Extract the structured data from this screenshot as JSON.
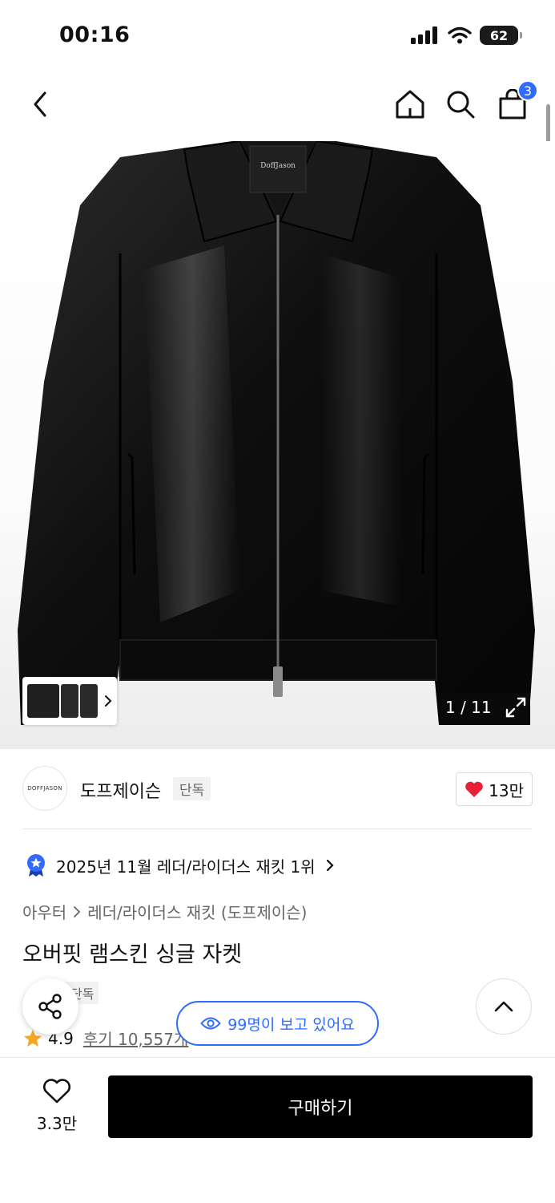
{
  "status_bar": {
    "time": "00:16",
    "battery": "62"
  },
  "nav": {
    "back_icon": "chevron-left-icon",
    "home_icon": "home-icon",
    "search_icon": "search-icon",
    "cart_icon": "shopping-bag-icon",
    "cart_count": "3"
  },
  "gallery": {
    "image": "black leather jacket product photo",
    "collar_label": "DoffJason",
    "page": "1 / 11"
  },
  "brand": {
    "logo_text": "DOFFJASON",
    "name": "도프제이슨",
    "tag": "단독",
    "likes": "13만"
  },
  "rank": {
    "text": "2025년 11월 레더/라이더스 재킷 1위"
  },
  "breadcrumb": {
    "category": "아우터",
    "subcategory": "레더/라이더스 재킷 (도프제이슨)"
  },
  "product": {
    "title": "오버핏 램스킨 싱글 자켓",
    "tag": "단독",
    "rating": "4.9",
    "reviews": "후기 10,557개"
  },
  "viewers": {
    "text": "99명이 보고 있어요"
  },
  "bottom_bar": {
    "wish_count": "3.3만",
    "buy_label": "구매하기"
  },
  "colors": {
    "accent_blue": "#2f6bff",
    "heart_red": "#e8203a",
    "star_orange": "#f5a623"
  }
}
